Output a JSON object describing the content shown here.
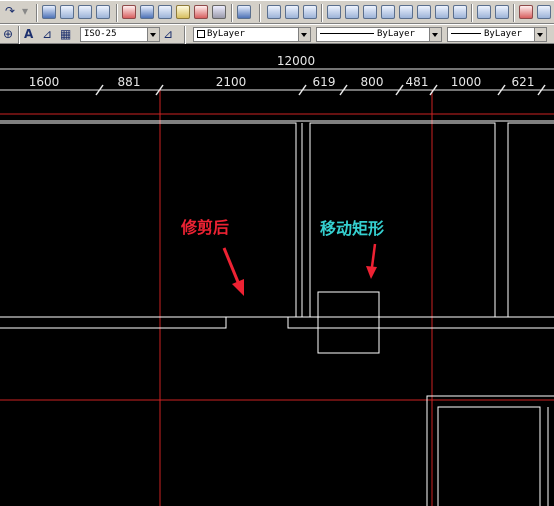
{
  "toolbar": {
    "dimstyle": "ISO-25",
    "layer_name": "",
    "color": "ByLayer",
    "linetype": "ByLayer",
    "lineweight": "ByLayer",
    "colors": {
      "face": "#d4d0c8",
      "field": "#ffffff"
    }
  },
  "drawing": {
    "overall_dimension": "12000",
    "segment_dimensions": [
      "1600",
      "881",
      "2100",
      "619",
      "800",
      "481",
      "1000",
      "621"
    ],
    "annotations": {
      "trimmed": "修剪后",
      "move_rectangle": "移动矩形"
    },
    "colors": {
      "background": "#000000",
      "wall": "#ffffff",
      "guide_line": "#cc2222",
      "dimension_text": "#e8e8e8",
      "trimmed_annotation": "#ee2233",
      "move_annotation": "#35d0d0"
    }
  }
}
